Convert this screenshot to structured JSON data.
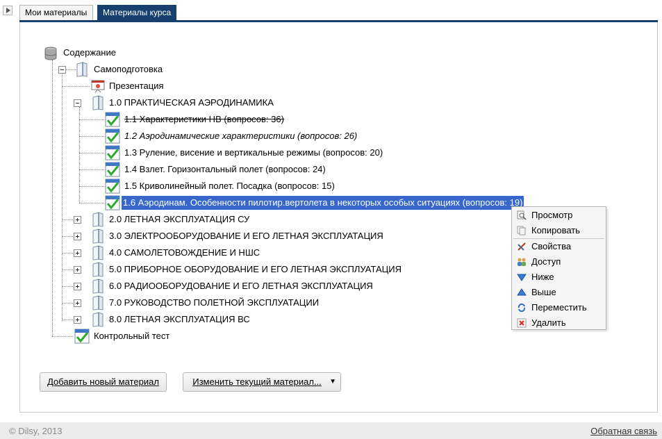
{
  "tabs": [
    {
      "label": "Мои материалы"
    },
    {
      "label": "Материалы курса"
    }
  ],
  "tree": {
    "root": "Содержание",
    "self_prep": "Самоподготовка",
    "presentation": "Презентация",
    "section1": "1.0 ПРАКТИЧЕСКАЯ АЭРОДИНАМИКА",
    "items": [
      "1.1 Характеристики НВ (вопросов: 36)",
      "1.2 Аэродинамические характеристики (вопросов: 26)",
      "1.3 Руление, висение и вертикальные режимы (вопросов: 20)",
      "1.4 Взлет. Горизонтальный полет (вопросов: 24)",
      "1.5 Криволинейный полет. Посадка (вопросов: 15)",
      "1.6 Аэродинам. Особенности пилотир.вертолета в некоторых особых ситуациях (вопросов: 19)"
    ],
    "sections": [
      "2.0 ЛЕТНАЯ ЭКСПЛУАТАЦИЯ СУ",
      "3.0 ЭЛЕКТРООБОРУДОВАНИЕ И ЕГО ЛЕТНАЯ ЭКСПЛУАТАЦИЯ",
      "4.0 САМОЛЕТОВОЖДЕНИЕ И НШС",
      "5.0 ПРИБОРНОЕ ОБОРУДОВАНИЕ И ЕГО ЛЕТНАЯ ЭКСПЛУАТАЦИЯ",
      "6.0 РАДИООБОРУДОВАНИЕ И ЕГО ЛЕТНАЯ ЭКСПЛУАТАЦИЯ",
      "7.0 РУКОВОДСТВО ПОЛЕТНОЙ ЭКСПЛУАТАЦИИ",
      "8.0 ЛЕТНАЯ ЭКСПЛУАТАЦИЯ ВС"
    ],
    "control_test": "Контрольный тест"
  },
  "context_menu": [
    "Просмотр",
    "Копировать",
    "Свойства",
    "Доступ",
    "Ниже",
    "Выше",
    "Переместить",
    "Удалить"
  ],
  "buttons": {
    "add": "Добавить новый материал",
    "edit": "Изменить текущий материал...",
    "dropdown_arrow": "▼"
  },
  "footer": {
    "copyright": "© Dilsy, 2013",
    "feedback": "Обратная связь"
  },
  "colors": {
    "accent": "#16416e",
    "selection": "#3766cc"
  }
}
